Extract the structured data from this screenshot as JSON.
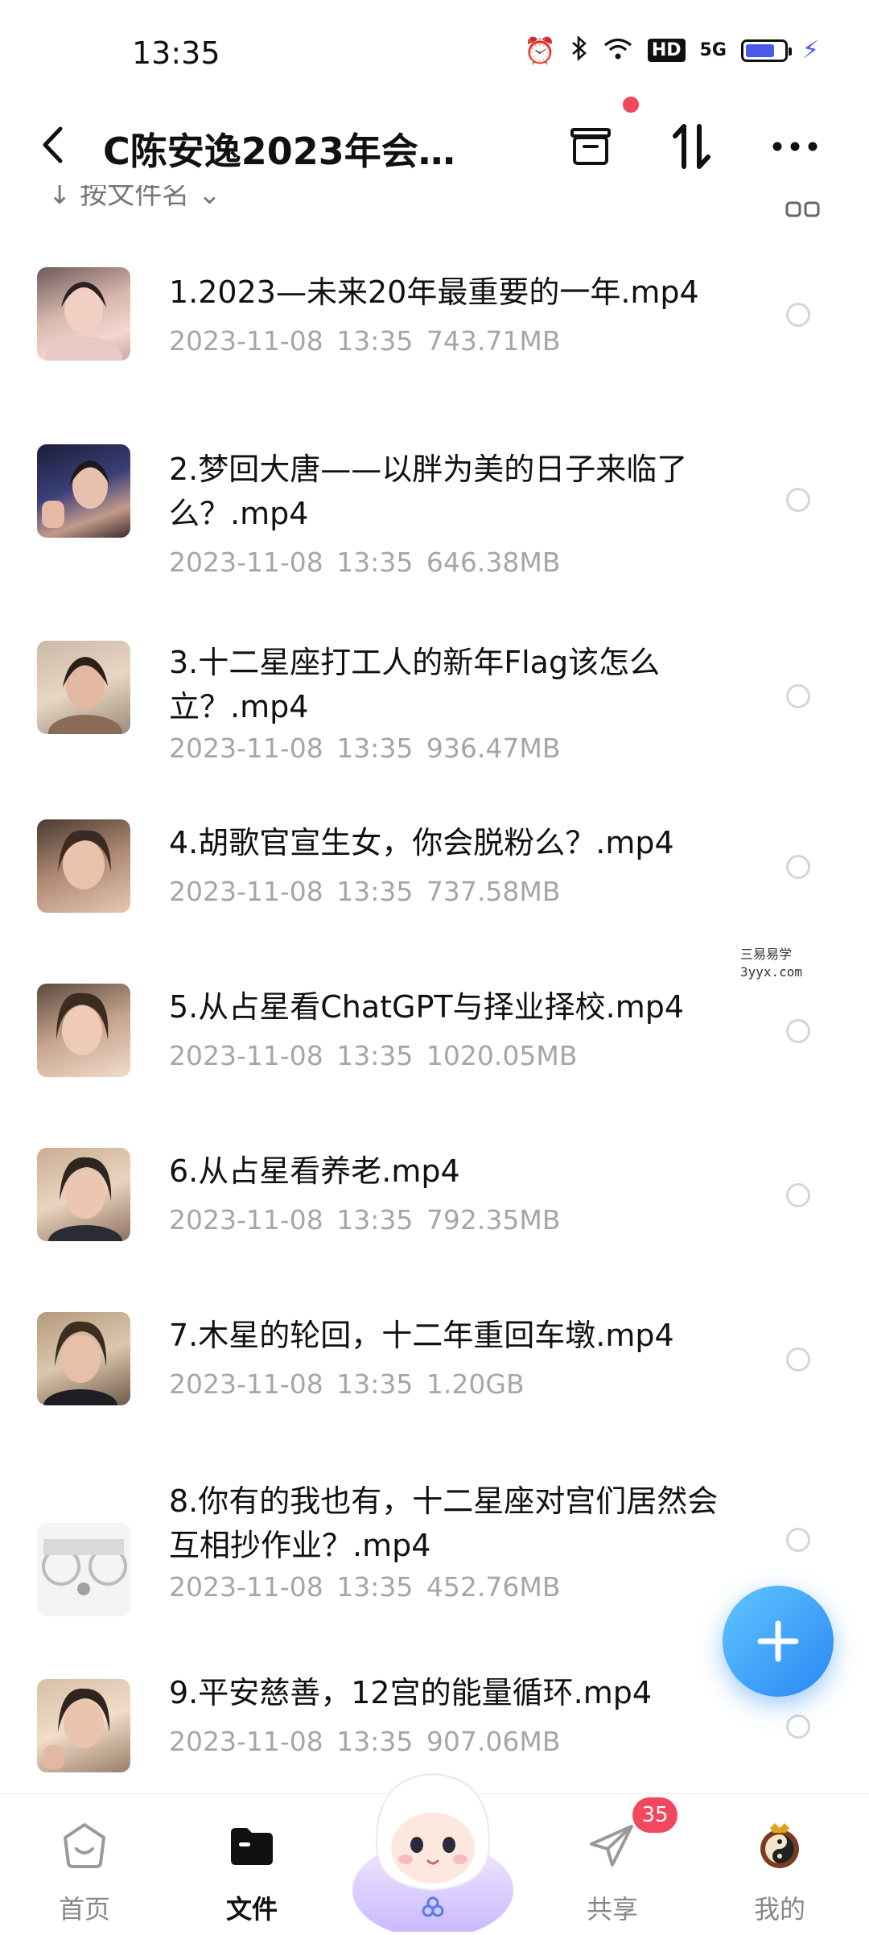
{
  "status_bar": {
    "time": "13:35",
    "hd_label": "HD",
    "signal_label": "5G",
    "battery_level": 0.75
  },
  "header": {
    "title": "C陈安逸2023年会员...",
    "back_icon": "chevron-left-icon",
    "actions": [
      "archive-icon",
      "sort-icon",
      "more-icon"
    ]
  },
  "sort_bar": {
    "label": "↓ 按文件名 ⌄"
  },
  "files": [
    {
      "name": "1.2023—未来20年最重要的一年.mp4",
      "date": "2023-11-08",
      "time": "13:35",
      "size": "743.71MB"
    },
    {
      "name": "2.梦回大唐——以胖为美的日子来临了么？.mp4",
      "date": "2023-11-08",
      "time": "13:35",
      "size": "646.38MB"
    },
    {
      "name": "3.十二星座打工人的新年Flag该怎么立？.mp4",
      "date": "2023-11-08",
      "time": "13:35",
      "size": "936.47MB"
    },
    {
      "name": "4.胡歌官宣生女，你会脱粉么？.mp4",
      "date": "2023-11-08",
      "time": "13:35",
      "size": "737.58MB"
    },
    {
      "name": "5.从占星看ChatGPT与择业择校.mp4",
      "date": "2023-11-08",
      "time": "13:35",
      "size": "1020.05MB"
    },
    {
      "name": "6.从占星看养老.mp4",
      "date": "2023-11-08",
      "time": "13:35",
      "size": "792.35MB"
    },
    {
      "name": "7.木星的轮回，十二年重回车墩.mp4",
      "date": "2023-11-08",
      "time": "13:35",
      "size": "1.20GB"
    },
    {
      "name": "8.你有的我也有，十二星座对宫们居然会互相抄作业？.mp4",
      "date": "2023-11-08",
      "time": "13:35",
      "size": "452.76MB"
    },
    {
      "name": "9.平安慈善，12宫的能量循环.mp4",
      "date": "2023-11-08",
      "time": "13:35",
      "size": "907.06MB"
    }
  ],
  "watermark": {
    "line1": "三易易学",
    "line2": "3yyx.com"
  },
  "fab": {
    "icon": "plus-icon"
  },
  "tabbar": {
    "tabs": [
      {
        "label": "首页",
        "icon": "home-icon"
      },
      {
        "label": "文件",
        "icon": "folder-icon"
      },
      {
        "label": "共享",
        "icon": "paper-plane-icon"
      },
      {
        "label": "我的",
        "icon": "avatar-icon"
      }
    ],
    "share_badge": "35",
    "mascot": "mascot-icon"
  },
  "colors": {
    "accent": "#2a86f4",
    "badge": "#f2475f",
    "meta_text": "#a6a6a6"
  }
}
